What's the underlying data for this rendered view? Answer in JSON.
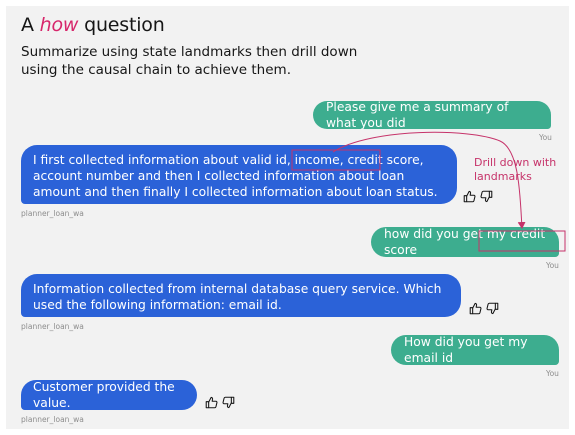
{
  "title": {
    "prefix": "A ",
    "emphasis": "how",
    "suffix": " question"
  },
  "subtitle": "Summarize using state landmarks then drill down using the causal chain to achieve them.",
  "annotation": "Drill down with landmarks",
  "messages": [
    {
      "role": "user",
      "text": "Please give me a summary of what you did",
      "meta": "You"
    },
    {
      "role": "bot",
      "text": "I first collected information about valid id, income, credit score, account number and then I collected information about loan amount and then finally I collected information about loan status.",
      "meta": "planner_loan_wa"
    },
    {
      "role": "user",
      "text": "how did you get my credit score",
      "meta": "You"
    },
    {
      "role": "bot",
      "text": "Information collected from internal database query service. Which used the following information: email id.",
      "meta": "planner_loan_wa"
    },
    {
      "role": "user",
      "text": "How did you get my email id",
      "meta": "You"
    },
    {
      "role": "bot",
      "text": "Customer provided the value.",
      "meta": "planner_loan_wa"
    }
  ],
  "icons": {
    "like": "thumbs-up-icon",
    "dislike": "thumbs-down-icon"
  },
  "colors": {
    "user_bubble": "#3dad8f",
    "bot_bubble": "#2b62d8",
    "annotation": "#c6336a",
    "title_emphasis": "#d7266b"
  }
}
